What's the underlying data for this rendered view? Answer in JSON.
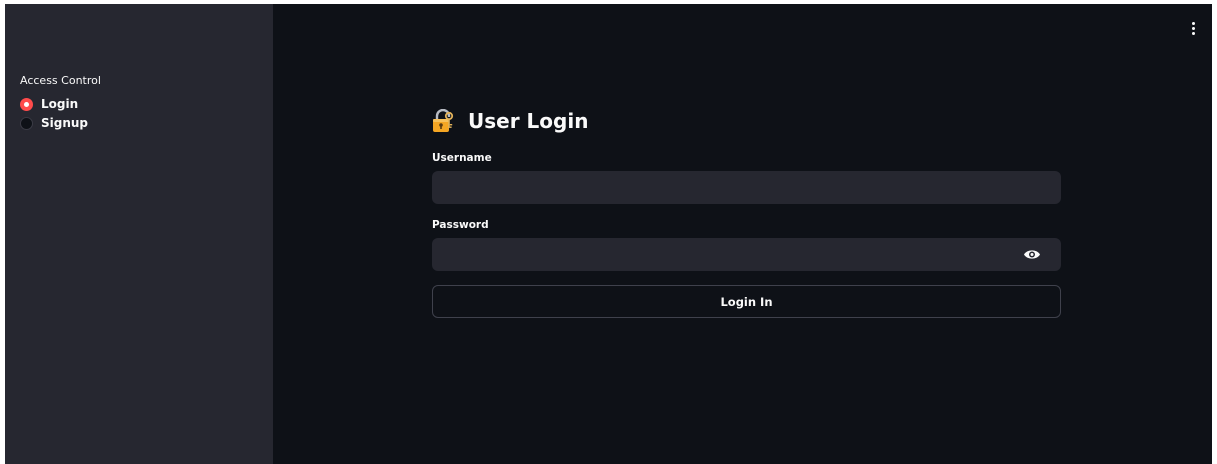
{
  "sidebar": {
    "label": "Access Control",
    "options": [
      {
        "label": "Login",
        "selected": true
      },
      {
        "label": "Signup",
        "selected": false
      }
    ]
  },
  "main": {
    "title": "User Login",
    "username_label": "Username",
    "username_value": "",
    "password_label": "Password",
    "password_value": "",
    "submit_label": "Login In"
  },
  "icons": {
    "title_icon": "lock-with-key-icon",
    "password_toggle": "eye-icon",
    "menu": "more-vertical-icon"
  },
  "colors": {
    "sidebar_bg": "#262730",
    "main_bg": "#0e1117",
    "accent": "#ff4b4b",
    "input_bg": "#262730",
    "text": "#fafafa"
  }
}
